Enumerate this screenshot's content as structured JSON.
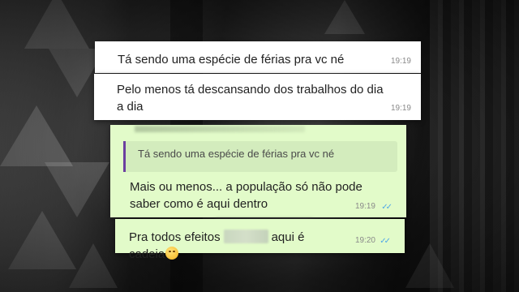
{
  "messages": [
    {
      "text": "Tá sendo uma espécie de férias pra vc né",
      "time": "19:19",
      "direction": "incoming"
    },
    {
      "text": "Pelo menos tá descansando dos trabalhos do dia a dia",
      "time": "19:19",
      "direction": "incoming"
    },
    {
      "quoted_text": "Tá sendo uma espécie de férias pra vc né",
      "text": "Mais ou menos... a população só não pode saber como é aqui dentro",
      "time": "19:19",
      "ticks": "✓✓",
      "direction": "outgoing"
    },
    {
      "text_before": "Pra todos efeitos",
      "text_after": "aqui é cadeia",
      "time": "19:20",
      "ticks": "✓✓",
      "direction": "outgoing"
    }
  ],
  "colors": {
    "incoming_bubble": "#ffffff",
    "outgoing_bubble": "#e2fbc9",
    "quote_bar": "#6b3fa0",
    "read_ticks": "#4fa8e8"
  },
  "icons": {
    "emoji": "slightly-smiling-face-icon",
    "read_receipt": "double-check-icon"
  }
}
